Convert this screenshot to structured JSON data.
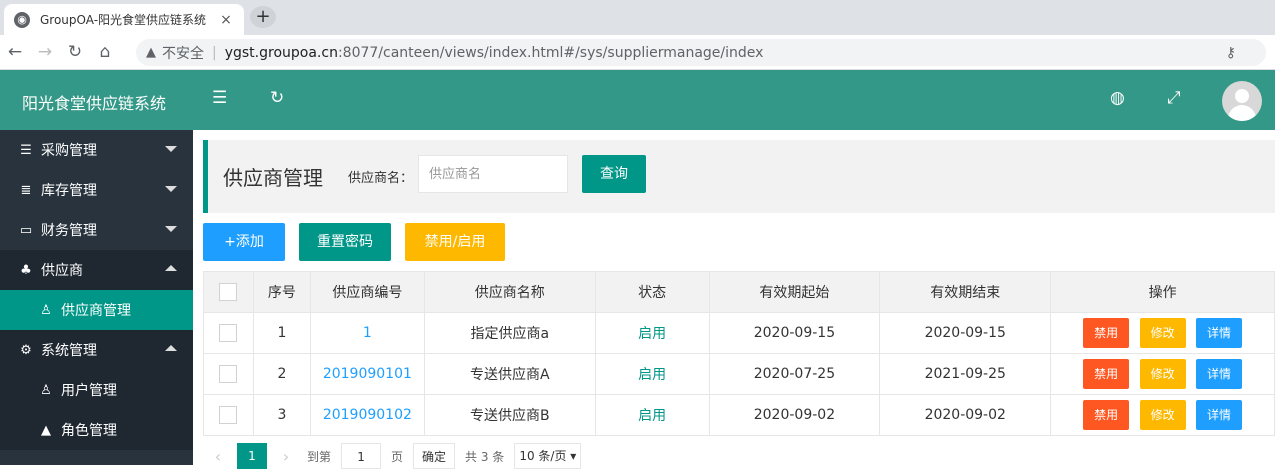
{
  "browser": {
    "tab_title": "GroupOA-阳光食堂供应链系统",
    "tab_close": "×",
    "new_tab": "+",
    "insecure_label": "不安全",
    "url_host": "ygst.groupoa.cn",
    "url_rest": ":8077/canteen/views/index.html#/sys/suppliermanage/index"
  },
  "header": {
    "brand": "阳光食堂供应链系统"
  },
  "sidebar": {
    "items": [
      {
        "label": "采购管理",
        "icon": "list-icon"
      },
      {
        "label": "库存管理",
        "icon": "database-icon"
      },
      {
        "label": "财务管理",
        "icon": "monitor-icon"
      },
      {
        "label": "供应商",
        "icon": "users-icon"
      },
      {
        "label": "供应商管理",
        "icon": "user-icon"
      },
      {
        "label": "系统管理",
        "icon": "gear-icon"
      },
      {
        "label": "用户管理",
        "icon": "user-icon"
      },
      {
        "label": "角色管理",
        "icon": "graduation-cap-icon"
      }
    ]
  },
  "search": {
    "title": "供应商管理",
    "label": "供应商名：",
    "placeholder": "供应商名",
    "query_label": "查询"
  },
  "toolbar": {
    "add_label": "+添加",
    "reset_label": "重置密码",
    "toggle_label": "禁用/启用"
  },
  "table": {
    "headers": [
      "序号",
      "供应商编号",
      "供应商名称",
      "状态",
      "有效期起始",
      "有效期结束",
      "操作"
    ],
    "rows": [
      {
        "no": "1",
        "code": "1",
        "name": "指定供应商a",
        "status": "启用",
        "start": "2020-09-15",
        "end": "2020-09-15"
      },
      {
        "no": "2",
        "code": "2019090101",
        "name": "专送供应商A",
        "status": "启用",
        "start": "2020-07-25",
        "end": "2021-09-25"
      },
      {
        "no": "3",
        "code": "2019090102",
        "name": "专送供应商B",
        "status": "启用",
        "start": "2020-09-02",
        "end": "2020-09-02"
      }
    ],
    "ops": {
      "disable": "禁用",
      "edit": "修改",
      "detail": "详情"
    }
  },
  "pager": {
    "current": "1",
    "goto_label": "到第",
    "goto_value": "1",
    "page_label": "页",
    "confirm": "确定",
    "total": "共 3 条",
    "page_size": "10 条/页"
  },
  "colors": {
    "header": "#339887",
    "sidebar": "#28333e",
    "accent": "#009688",
    "blue": "#1e9fff",
    "orange": "#ffb800",
    "red": "#ff5722"
  }
}
